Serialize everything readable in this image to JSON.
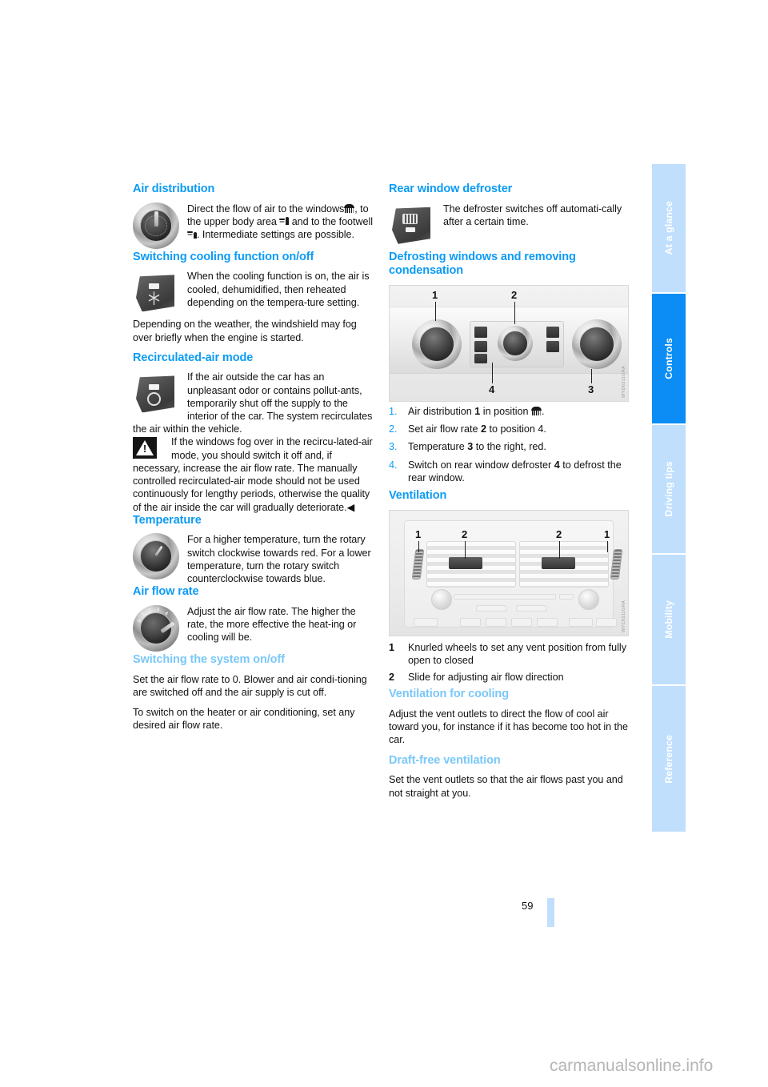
{
  "page": {
    "number": "59",
    "watermark": "carmanualsonline.info"
  },
  "tabs": [
    {
      "label": "At a glance",
      "active": false
    },
    {
      "label": "Controls",
      "active": true
    },
    {
      "label": "Driving tips",
      "active": false
    },
    {
      "label": "Mobility",
      "active": false
    },
    {
      "label": "Reference",
      "active": false
    }
  ],
  "colors": {
    "heading": "#0b9bf5",
    "subheading": "#79c8f8",
    "tab_active": "#0b8df5",
    "tab_inactive": "#bfdffd",
    "body_text": "#111111"
  },
  "left_column": {
    "air_distribution": {
      "heading": "Air distribution",
      "icon": "rotary-knob-air-distribution",
      "text_1": "Direct the flow of air to the windows",
      "text_2": ", to the upper body area",
      "text_3": "and to the footwell",
      "text_4": ". Intermediate settings are possible.",
      "full_text": "Direct the flow of air to the windows ▒, to the upper body area ▒ and to the footwell ▒. Intermediate settings are possible."
    },
    "cooling": {
      "heading": "Switching cooling function on/off",
      "icon": "snowflake-button",
      "paragraph_1": "When the cooling function is on, the air is cooled, dehumidified, then reheated depending on the tempera-ture setting.",
      "paragraph_2": "Depending on the weather, the windshield may fog over briefly when the engine is started."
    },
    "recirculated": {
      "heading": "Recirculated-air mode",
      "icon": "recirculation-button",
      "paragraph_1": "If the air outside the car has an unpleasant odor or contains pollut-ants, temporarily shut off the supply to the interior of the car. The system recirculates the air within the vehicle.",
      "warning_icon": "warning-triangle-icon",
      "warning_text": "If the windows fog over in the recircu-lated-air mode, you should switch it off and, if necessary, increase the air flow rate. The manually controlled recirculated-air mode should not be used continuously for lengthy periods, otherwise the quality of the air inside the car will gradually deteriorate.",
      "warning_end_marker": "◀"
    },
    "temperature": {
      "heading": "Temperature",
      "icon": "rotary-knob-temperature",
      "paragraph_1": "For a higher temperature, turn the rotary switch clockwise towards red. For a lower temperature, turn the rotary switch counterclockwise towards blue."
    },
    "air_flow_rate": {
      "heading": "Air flow rate",
      "icon": "rotary-knob-air-flow",
      "paragraph_1": "Adjust the air flow rate. The higher the rate, the more effective the heat-ing or cooling will be."
    },
    "switching_system": {
      "heading": "Switching the system on/off",
      "paragraph_1": "Set the air flow rate to 0. Blower and air condi-tioning are switched off and the air supply is cut off.",
      "paragraph_2": "To switch on the heater or air conditioning, set any desired air flow rate."
    }
  },
  "right_column": {
    "rear_defroster": {
      "heading": "Rear window defroster",
      "icon": "rear-defroster-button",
      "paragraph_1": "The defroster switches off automati-cally after a certain time."
    },
    "defrosting": {
      "heading": "Defrosting windows and removing condensation",
      "figure": {
        "name": "climate-control-panel-figure",
        "callouts": [
          "1",
          "2",
          "3",
          "4"
        ],
        "code": "WYD6511GRA"
      },
      "steps": [
        {
          "n": "1.",
          "text_before": "Air distribution ",
          "bold": "1",
          "text_after": " in position ",
          "symbol": "defrost-symbol",
          "text_end": "."
        },
        {
          "n": "2.",
          "text_before": "Set air flow rate ",
          "bold": "2",
          "text_after": " to position 4."
        },
        {
          "n": "3.",
          "text_before": "Temperature ",
          "bold": "3",
          "text_after": " to the right, red."
        },
        {
          "n": "4.",
          "text_before": "Switch on rear window defroster ",
          "bold": "4",
          "text_after": " to defrost the rear window."
        }
      ]
    },
    "ventilation": {
      "heading": "Ventilation",
      "figure": {
        "name": "dashboard-vents-figure",
        "callouts": [
          "1",
          "2",
          "2",
          "1"
        ],
        "code": "WYC6511GRA"
      },
      "keys": [
        {
          "n": "1",
          "text": "Knurled wheels to set any vent position from fully open to closed"
        },
        {
          "n": "2",
          "text": "Slide for adjusting air flow direction"
        }
      ]
    },
    "ventilation_cooling": {
      "heading": "Ventilation for cooling",
      "paragraph_1": "Adjust the vent outlets to direct the flow of cool air toward you, for instance if it has become too hot in the car."
    },
    "draft_free": {
      "heading": "Draft-free ventilation",
      "paragraph_1": "Set the vent outlets so that the air flows past you and not straight at you."
    }
  }
}
